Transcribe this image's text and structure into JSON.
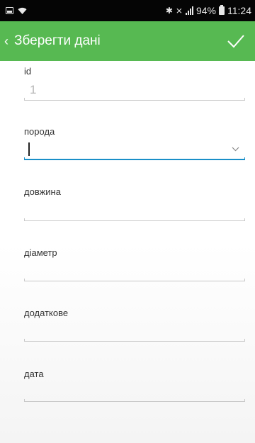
{
  "statusbar": {
    "icons_left": [
      "gallery-icon",
      "wifi-icon"
    ],
    "icons_right": [
      "bluetooth-icon",
      "mute-icon",
      "signal-icon"
    ],
    "battery": "94%",
    "time": "11:24"
  },
  "toolbar": {
    "title": "Зберегти дані",
    "back_icon": "chevron-left-icon",
    "confirm_icon": "check-icon",
    "background": "#57b952"
  },
  "form": {
    "fields": [
      {
        "label": "id",
        "value": "1",
        "disabled": true
      },
      {
        "label": "порода",
        "value": "",
        "focused": true,
        "type": "dropdown"
      },
      {
        "label": "довжина",
        "value": ""
      },
      {
        "label": "діаметр",
        "value": ""
      },
      {
        "label": "додаткове",
        "value": ""
      },
      {
        "label": "дата",
        "value": ""
      }
    ],
    "accent_color": "#1a8fc8"
  }
}
